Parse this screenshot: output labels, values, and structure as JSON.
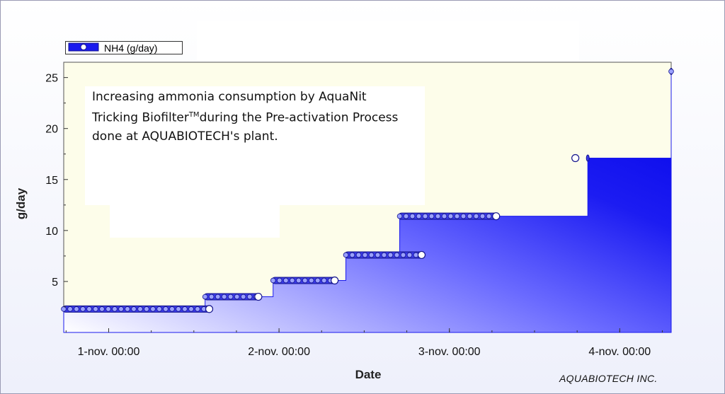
{
  "chart_data": {
    "type": "area",
    "xlabel": "Date",
    "ylabel": "g/day",
    "ylim": [
      0,
      26.5
    ],
    "yticks": [
      5,
      10,
      15,
      20,
      25
    ],
    "x_range": [
      "31-oct. 17:40",
      "4-nov. 07:15"
    ],
    "xtick_labels": [
      "1-nov. 00:00",
      "2-nov. 00:00",
      "3-nov. 00:00",
      "4-nov. 00:00"
    ],
    "grid": false,
    "legend_position": "top-left",
    "series": [
      {
        "name": "NH4 (g/day)",
        "color": "#1a1aee",
        "step_start": [
          "31-oct. 17:40",
          "1-nov. 13:35",
          "1-nov. 23:10",
          "2-nov. 09:25",
          "2-nov. 17:00",
          "3-nov. 19:30",
          "4-nov. 07:15"
        ],
        "x_end": [
          "1-nov. 14:10",
          "1-nov. 21:05",
          "2-nov. 07:50",
          "2-nov. 20:05",
          "3-nov. 06:35",
          "3-nov. 17:45",
          "4-nov. 07:15"
        ],
        "values": [
          2.3,
          3.5,
          5.1,
          7.6,
          11.4,
          17.1,
          25.6
        ]
      }
    ],
    "annotation": {
      "line1": "Increasing ammonia consumption by AquaNit",
      "line2_a": "Tricking Biofilter",
      "line2_sup": "TM",
      "line2_b": "during the Pre-activation Process",
      "line3": "done at AQUABIOTECH's plant."
    }
  },
  "footer": "AQUABIOTECH INC.",
  "colors": {
    "plot_bg": "#fdfdea",
    "fill_start": "#ffffff",
    "fill_end": "#0000e8",
    "marker_stroke": "#14148c"
  }
}
